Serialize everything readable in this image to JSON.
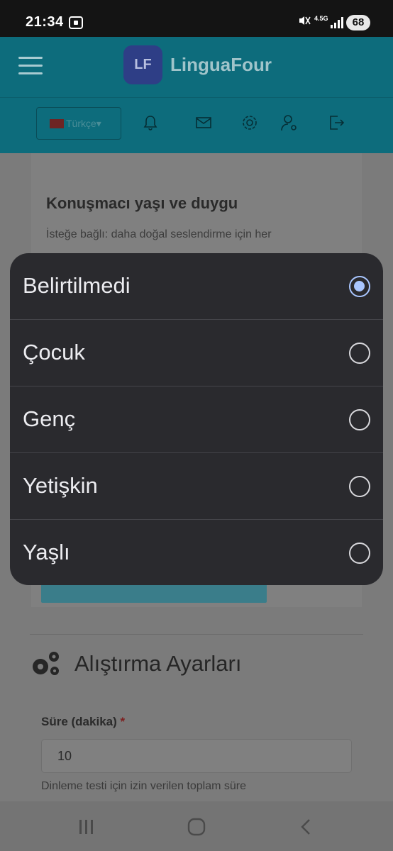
{
  "status_bar": {
    "time": "21:34",
    "network": "4.5G",
    "battery": "68"
  },
  "header": {
    "logo_initials": "LF",
    "app_name": "LinguaFour",
    "language": "Türkçe"
  },
  "content": {
    "card_title": "Konuşmacı yaşı ve duygu",
    "card_description": "İsteğe bağlı: daha doğal seslendirme için her",
    "section_title": "Alıştırma Ayarları",
    "duration_label": "Süre (dakika)",
    "required_mark": "*",
    "duration_value": "10",
    "duration_help": "Dinleme testi için izin verilen toplam süre"
  },
  "dialog": {
    "selected_index": 0,
    "options": [
      {
        "label": "Belirtilmedi"
      },
      {
        "label": "Çocuk"
      },
      {
        "label": "Genç"
      },
      {
        "label": "Yetişkin"
      },
      {
        "label": "Yaşlı"
      }
    ]
  },
  "colors": {
    "header_bg": "#12a5be",
    "dialog_bg": "#2a2a2e",
    "radio_selected": "#a9c6ff"
  }
}
